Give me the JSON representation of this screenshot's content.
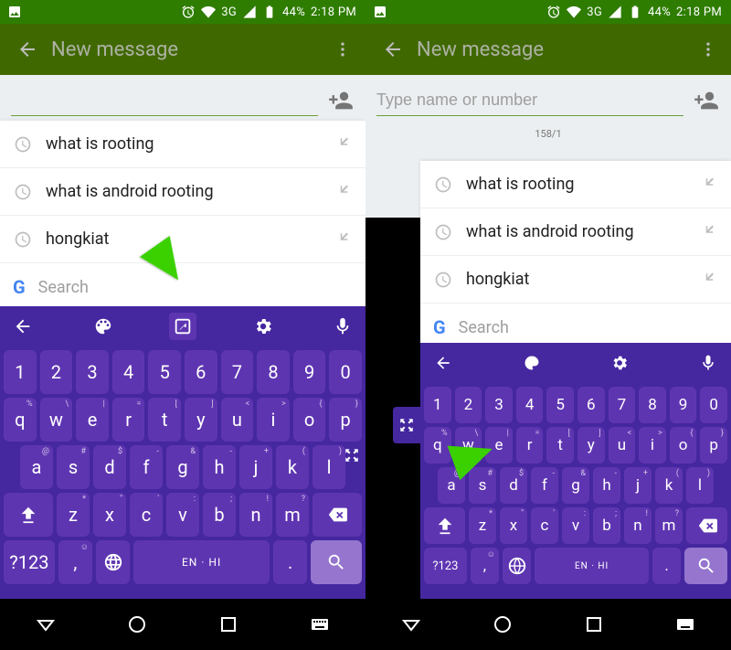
{
  "statusbar": {
    "network": "3G",
    "battery": "44%",
    "time": "2:18 PM"
  },
  "appbar": {
    "title": "New message"
  },
  "recipient": {
    "placeholder": "Type name or number",
    "char_count": "158/1"
  },
  "suggestions": [
    {
      "text": "what is rooting"
    },
    {
      "text": "what is android rooting"
    },
    {
      "text": "hongkiat"
    }
  ],
  "search": {
    "placeholder": "Search"
  },
  "keyboard": {
    "row1": [
      "1",
      "2",
      "3",
      "4",
      "5",
      "6",
      "7",
      "8",
      "9",
      "0"
    ],
    "row2": [
      {
        "k": "q",
        "s": "%"
      },
      {
        "k": "w",
        "s": "\\"
      },
      {
        "k": "e",
        "s": "|"
      },
      {
        "k": "r",
        "s": "="
      },
      {
        "k": "t",
        "s": "["
      },
      {
        "k": "y",
        "s": "]"
      },
      {
        "k": "u",
        "s": "<"
      },
      {
        "k": "i",
        "s": ">"
      },
      {
        "k": "o",
        "s": "{"
      },
      {
        "k": "p",
        "s": "}"
      }
    ],
    "row3": [
      {
        "k": "a",
        "s": "@"
      },
      {
        "k": "s",
        "s": "#"
      },
      {
        "k": "d",
        "s": "$"
      },
      {
        "k": "f",
        "s": "-"
      },
      {
        "k": "g",
        "s": "&"
      },
      {
        "k": "h",
        "s": "-"
      },
      {
        "k": "j",
        "s": "+"
      },
      {
        "k": "k",
        "s": "("
      },
      {
        "k": "l",
        "s": ")"
      }
    ],
    "row4": [
      {
        "k": "z",
        "s": "*"
      },
      {
        "k": "x",
        "s": "\""
      },
      {
        "k": "c",
        "s": "'"
      },
      {
        "k": "v",
        "s": ":"
      },
      {
        "k": "b",
        "s": ";"
      },
      {
        "k": "n",
        "s": "!"
      },
      {
        "k": "m",
        "s": "?"
      }
    ],
    "symkey": "?123",
    "space": "EN · HI",
    "comma": ",",
    "period": "."
  }
}
